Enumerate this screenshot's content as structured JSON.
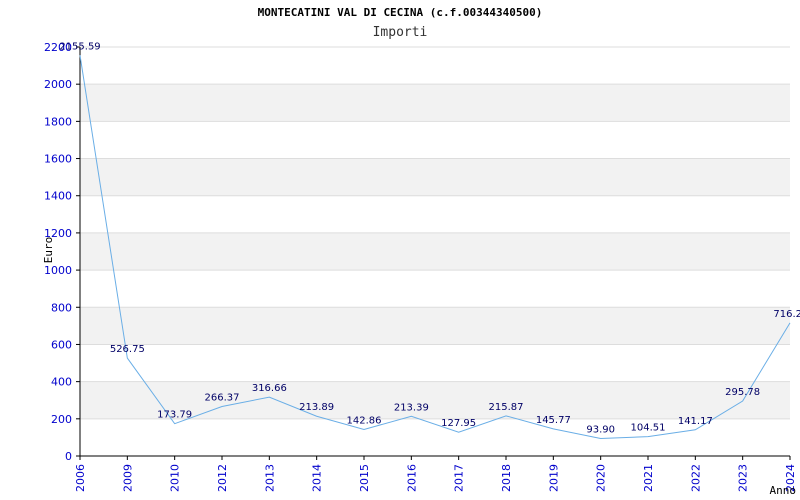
{
  "chart_data": {
    "type": "line",
    "title": "MONTECATINI VAL DI CECINA (c.f.00344340500)",
    "subtitle": "Importi",
    "xlabel": "Anno",
    "ylabel": "Euro",
    "ylim": [
      0,
      2200
    ],
    "yticks": [
      0,
      200,
      400,
      600,
      800,
      1000,
      1200,
      1400,
      1600,
      1800,
      2000,
      2200
    ],
    "grid": true,
    "colors": {
      "line": "#6aaee6",
      "band": "#f2f2f2",
      "tick_text": "#0000cc",
      "data_label": "#000066",
      "axis": "#000000"
    },
    "categories": [
      "2006",
      "2009",
      "2010",
      "2012",
      "2013",
      "2014",
      "2015",
      "2016",
      "2017",
      "2018",
      "2019",
      "2020",
      "2021",
      "2022",
      "2023",
      "2024"
    ],
    "values": [
      2155.59,
      526.75,
      173.79,
      266.37,
      316.66,
      213.89,
      142.86,
      213.39,
      127.95,
      215.87,
      145.77,
      93.9,
      104.51,
      141.17,
      295.78,
      716.2
    ],
    "value_labels": [
      "2155.59",
      "526.75",
      "173.79",
      "266.37",
      "316.66",
      "213.89",
      "142.86",
      "213.39",
      "127.95",
      "215.87",
      "145.77",
      "93.90",
      "104.51",
      "141.17",
      "295.78",
      "716.2"
    ]
  }
}
